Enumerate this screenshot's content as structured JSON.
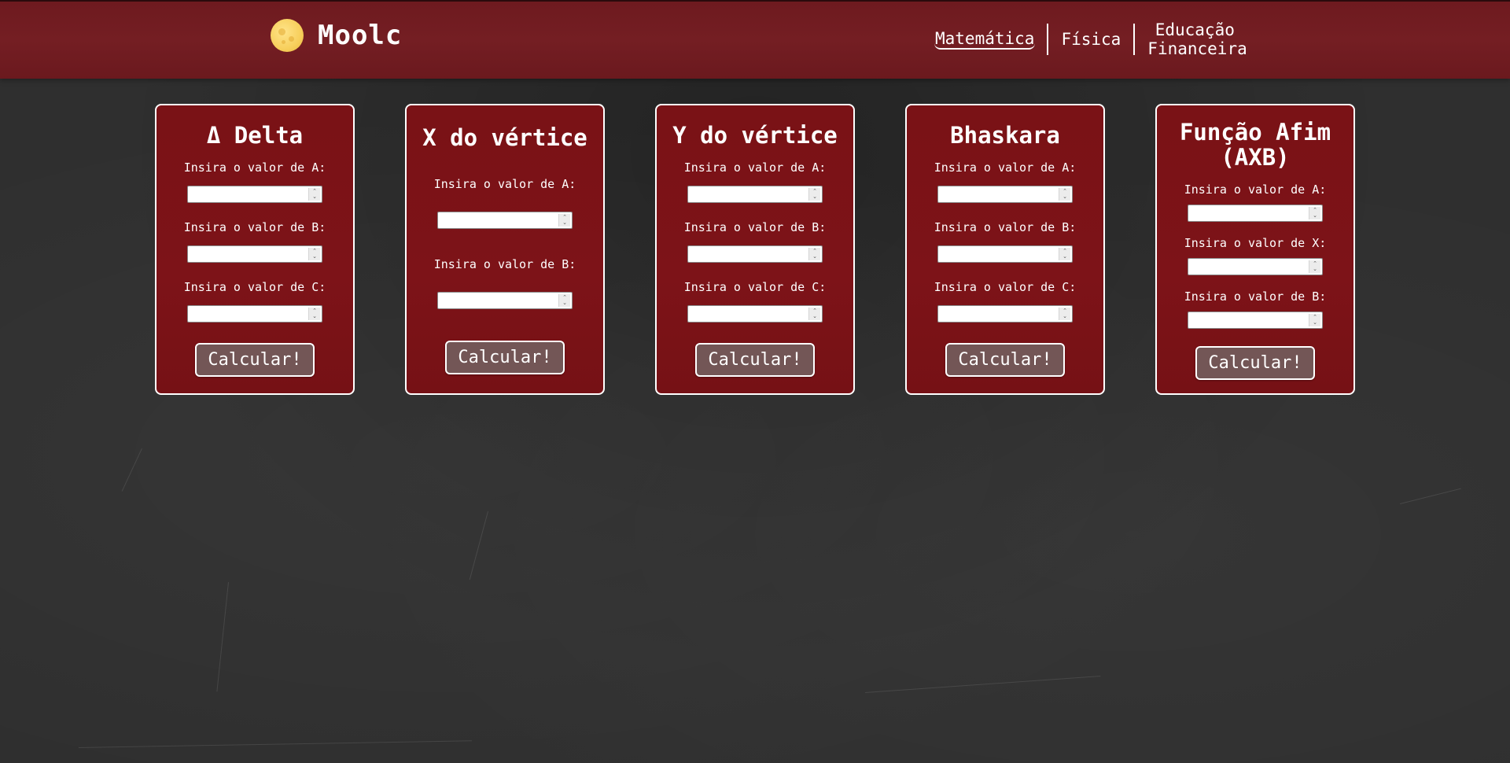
{
  "header": {
    "brand": "Moolc",
    "nav": [
      {
        "label": "Matemática"
      },
      {
        "label": "Física"
      },
      {
        "label": "Educação Financeira"
      }
    ]
  },
  "cards": [
    {
      "title": "Δ Delta",
      "fields": [
        {
          "label": "Insira o valor de A:",
          "value": ""
        },
        {
          "label": "Insira o valor de B:",
          "value": ""
        },
        {
          "label": "Insira o valor de C:",
          "value": ""
        }
      ],
      "button": "Calcular!"
    },
    {
      "title": "X do vértice",
      "fields": [
        {
          "label": "Insira o valor de A:",
          "value": ""
        },
        {
          "label": "Insira o valor de B:",
          "value": ""
        }
      ],
      "button": "Calcular!"
    },
    {
      "title": "Y do vértice",
      "fields": [
        {
          "label": "Insira o valor de A:",
          "value": ""
        },
        {
          "label": "Insira o valor de B:",
          "value": ""
        },
        {
          "label": "Insira o valor de C:",
          "value": ""
        }
      ],
      "button": "Calcular!"
    },
    {
      "title": "Bhaskara",
      "fields": [
        {
          "label": "Insira o valor de A:",
          "value": ""
        },
        {
          "label": "Insira o valor de B:",
          "value": ""
        },
        {
          "label": "Insira o valor de C:",
          "value": ""
        }
      ],
      "button": "Calcular!"
    },
    {
      "title": "Função Afim (AXB)",
      "fields": [
        {
          "label": "Insira o valor de A:",
          "value": ""
        },
        {
          "label": "Insira o valor de X:",
          "value": ""
        },
        {
          "label": "Insira o valor de B:",
          "value": ""
        }
      ],
      "button": "Calcular!"
    }
  ],
  "colors": {
    "header_bg": "#731c21",
    "card_bg": "#7b1317",
    "button_bg": "#735656",
    "board_bg": "#2f2f2f",
    "logo": "#f7cf5c"
  },
  "icons": {
    "logo": "moon-icon",
    "spinner": "spinner-arrows-icon"
  }
}
